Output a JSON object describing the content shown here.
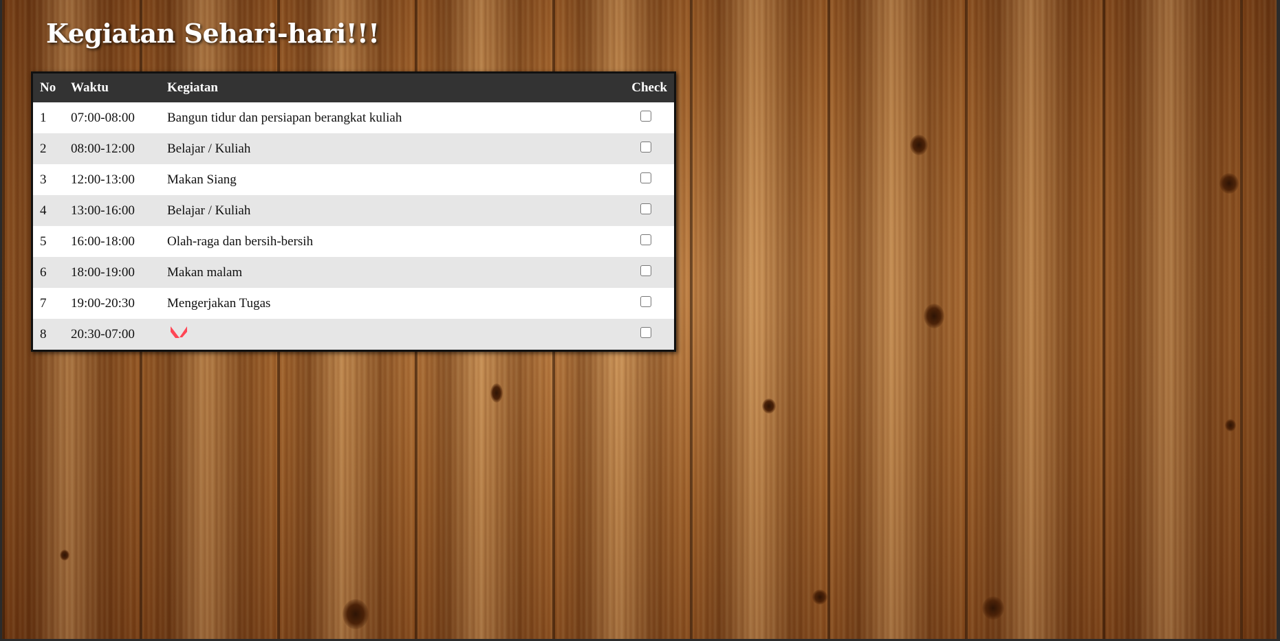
{
  "page": {
    "title": "Kegiatan Sehari-hari!!!"
  },
  "table": {
    "headers": {
      "no": "No",
      "waktu": "Waktu",
      "kegiatan": "Kegiatan",
      "check": "Check"
    },
    "rows": [
      {
        "no": "1",
        "waktu": "07:00-08:00",
        "kegiatan": "Bangun tidur dan persiapan berangkat kuliah",
        "checked": false
      },
      {
        "no": "2",
        "waktu": "08:00-12:00",
        "kegiatan": "Belajar / Kuliah",
        "checked": false
      },
      {
        "no": "3",
        "waktu": "12:00-13:00",
        "kegiatan": "Makan Siang",
        "checked": false
      },
      {
        "no": "4",
        "waktu": "13:00-16:00",
        "kegiatan": "Belajar / Kuliah",
        "checked": false
      },
      {
        "no": "5",
        "waktu": "16:00-18:00",
        "kegiatan": "Olah-raga dan bersih-bersih",
        "checked": false
      },
      {
        "no": "6",
        "waktu": "18:00-19:00",
        "kegiatan": "Makan malam",
        "checked": false
      },
      {
        "no": "7",
        "waktu": "19:00-20:30",
        "kegiatan": "Mengerjakan Tugas",
        "checked": false
      },
      {
        "no": "8",
        "waktu": "20:30-07:00",
        "kegiatan": "",
        "icon": "valorant-logo-icon",
        "checked": false
      }
    ]
  },
  "colors": {
    "header_bg": "#333333",
    "row_alt_bg": "#e6e6e6",
    "logo_red": "#ff4655"
  }
}
